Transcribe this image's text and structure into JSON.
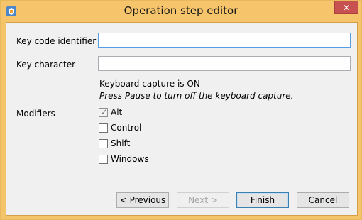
{
  "window": {
    "title": "Operation step editor",
    "close_glyph": "✕",
    "icon": "app-icon",
    "frame_color": "#f3c46a"
  },
  "form": {
    "key_code_label": "Key code identifier",
    "key_code_value": "",
    "key_character_label": "Key character",
    "key_character_value": "",
    "capture_status": "Keyboard capture is ON",
    "capture_hint": "Press Pause to turn off the keyboard capture.",
    "modifiers_label": "Modifiers"
  },
  "modifiers": [
    {
      "label": "Alt",
      "checked": true
    },
    {
      "label": "Control",
      "checked": false
    },
    {
      "label": "Shift",
      "checked": false
    },
    {
      "label": "Windows",
      "checked": false
    }
  ],
  "buttons": {
    "previous": "< Previous",
    "next": "Next >",
    "finish": "Finish",
    "cancel": "Cancel"
  }
}
